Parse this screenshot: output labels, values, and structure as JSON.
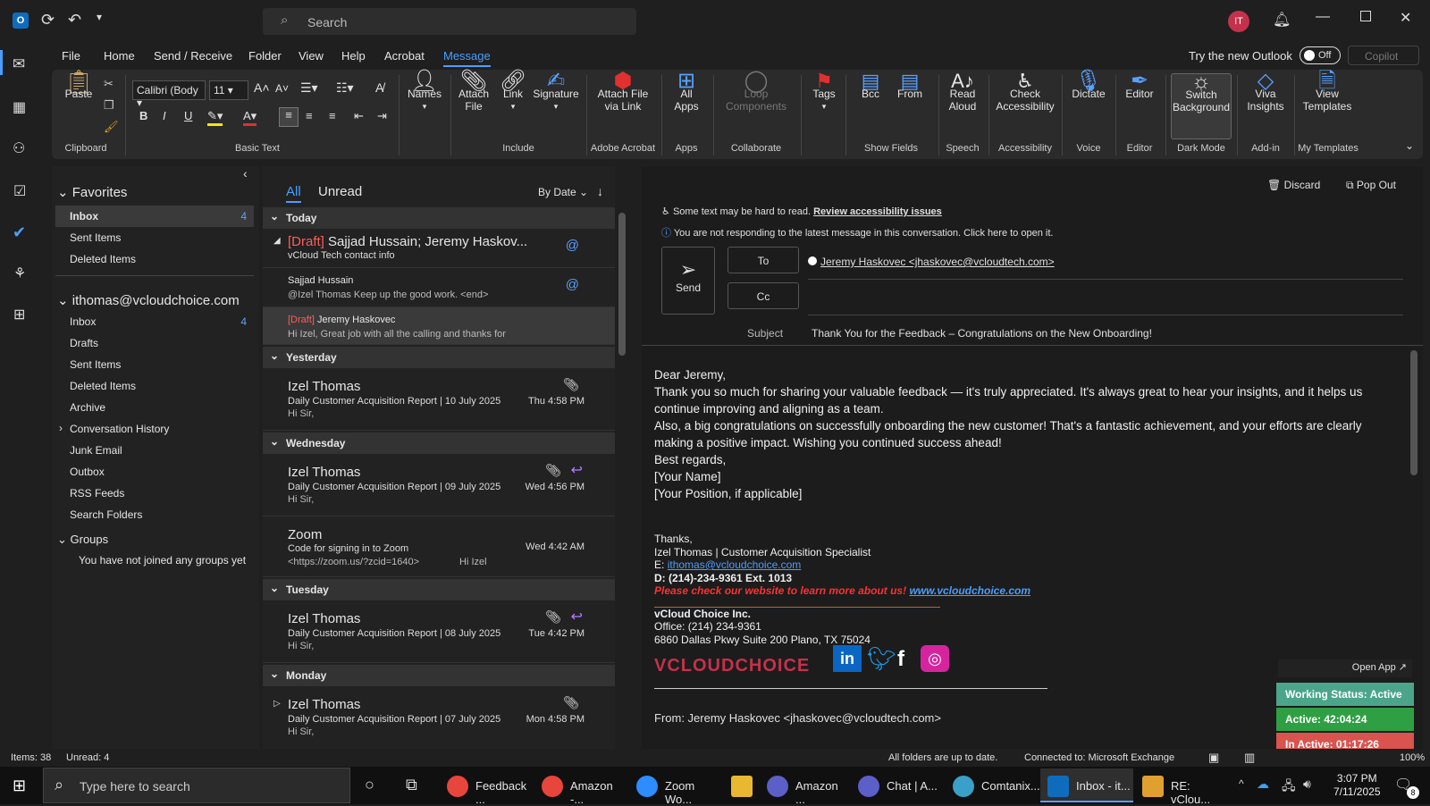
{
  "titlebar": {
    "search_placeholder": "Search",
    "avatar": "IT"
  },
  "menu": {
    "items": [
      "File",
      "Home",
      "Send / Receive",
      "Folder",
      "View",
      "Help",
      "Acrobat",
      "Message"
    ],
    "try_new": "Try the new Outlook",
    "toggle": "Off",
    "copilot": "Copilot"
  },
  "ribbon": {
    "paste": "Paste",
    "font": "Calibri (Body",
    "size": "11",
    "names": "Names",
    "attach": "Attach\nFile",
    "link": "Link",
    "signature": "Signature",
    "attach_link": "Attach File\nvia Link",
    "all_apps": "All\nApps",
    "loop": "Loop\nComponents",
    "tags": "Tags",
    "bcc": "Bcc",
    "from": "From",
    "read_aloud": "Read\nAloud",
    "check_acc": "Check\nAccessibility",
    "dictate": "Dictate",
    "editor": "Editor",
    "switch_bg": "Switch\nBackground",
    "viva": "Viva\nInsights",
    "view_templates": "View\nTemplates",
    "groups": [
      "Clipboard",
      "Basic Text",
      "Include",
      "Adobe Acrobat",
      "Apps",
      "Collaborate",
      "Show Fields",
      "Speech",
      "Accessibility",
      "Voice",
      "Editor",
      "Dark Mode",
      "Add-in",
      "My Templates"
    ]
  },
  "folders": {
    "favorites": "Favorites",
    "fav_items": [
      {
        "label": "Inbox",
        "count": "4"
      },
      {
        "label": "Sent Items",
        "count": ""
      },
      {
        "label": "Deleted Items",
        "count": ""
      }
    ],
    "account": "ithomas@vcloudchoice.com",
    "acc_items": [
      {
        "label": "Inbox",
        "count": "4"
      },
      {
        "label": "Drafts",
        "count": ""
      },
      {
        "label": "Sent Items",
        "count": ""
      },
      {
        "label": "Deleted Items",
        "count": ""
      },
      {
        "label": "Archive",
        "count": ""
      },
      {
        "label": "Conversation History",
        "count": ""
      },
      {
        "label": "Junk Email",
        "count": ""
      },
      {
        "label": "Outbox",
        "count": ""
      },
      {
        "label": "RSS Feeds",
        "count": ""
      },
      {
        "label": "Search Folders",
        "count": ""
      }
    ],
    "groups": "Groups",
    "groups_msg": "You have not joined any groups yet"
  },
  "list": {
    "tab_all": "All",
    "tab_unread": "Unread",
    "sort": "By Date",
    "h_today": "Today",
    "h_yesterday": "Yesterday",
    "h_wed": "Wednesday",
    "h_tue": "Tuesday",
    "h_mon": "Monday",
    "m1_draft": "[Draft]",
    "m1_sender": "Sajjad Hussain;  Jeremy Haskov...",
    "m1_subj": "vCloud Tech contact info",
    "m2_sender": "Sajjad Hussain",
    "m2_prev": "@Izel Thomas Keep up the good work. <end>",
    "m3_draft": "[Draft]",
    "m3_sender": "Jeremy Haskovec",
    "m3_prev": "Hi Izel,  Great job with all the calling and thanks for",
    "m4_sender": "Izel Thomas",
    "m4_subj": "Daily Customer Acquisition Report | 10 July 2025",
    "m4_time": "Thu 4:58 PM",
    "m4_prev": "Hi Sir,",
    "m5_sender": "Izel Thomas",
    "m5_subj": "Daily Customer Acquisition Report | 09 July 2025",
    "m5_time": "Wed 4:56 PM",
    "m5_prev": "Hi Sir,",
    "m6_sender": "Zoom",
    "m6_subj": "Code for signing in to Zoom",
    "m6_time": "Wed 4:42 AM",
    "m6_prev": "<https://zoom.us/?zcid=1640>",
    "m6_prev2": "Hi Izel",
    "m7_sender": "Izel Thomas",
    "m7_subj": "Daily Customer Acquisition Report | 08 July 2025",
    "m7_time": "Tue 4:42 PM",
    "m7_prev": "Hi Sir,",
    "m8_sender": "Izel Thomas",
    "m8_subj": "Daily Customer Acquisition Report | 07 July 2025",
    "m8_time": "Mon 4:58 PM",
    "m8_prev": "Hi Sir,"
  },
  "compose": {
    "discard": "Discard",
    "popout": "Pop Out",
    "access_msg": "Some text may be hard to read.",
    "access_link": "Review accessibility issues",
    "info_msg": "You are not responding to the latest message in this conversation. Click here to open it.",
    "send": "Send",
    "to": "To",
    "cc": "Cc",
    "to_value": "Jeremy Haskovec <jhaskovec@vcloudtech.com>",
    "subject_label": "Subject",
    "subject": "Thank You for the Feedback – Congratulations on the New Onboarding!",
    "body": [
      "Dear Jeremy,",
      "Thank you so much for sharing your valuable feedback — it's truly appreciated. It's always great to hear your insights, and it helps us continue improving and aligning as a team.",
      "Also, a big congratulations on successfully onboarding the new customer! That's a fantastic achievement, and your efforts are clearly making a positive impact. Wishing you continued success ahead!",
      "Best regards,",
      "[Your Name]",
      "[Your Position, if applicable]"
    ],
    "sig_thanks": "Thanks,",
    "sig_name": "Izel Thomas | Customer Acquisition Specialist",
    "sig_email_label": "E:",
    "sig_email": "ithomas@vcloudchoice.com",
    "sig_phone": "D: (214)-234-9361 Ext. 1013",
    "sig_web_msg": "Please check our website to learn more about us!",
    "sig_web": "www.vcloudchoice.com",
    "company": "vCloud Choice Inc.",
    "office": "Office: (214) 234-9361",
    "address": "6860 Dallas Pkwy Suite 200 Plano, TX 75024",
    "logo": "VCLOUDCHOICE",
    "from_line": "From: Jeremy Haskovec <jhaskovec@vcloudtech.com>"
  },
  "widget": {
    "open_app": "Open App",
    "working": "Working Status: Active",
    "active": "Active: 42:04:24",
    "inactive": "In Active: 01:17:26"
  },
  "status": {
    "items": "Items: 38",
    "unread": "Unread: 4",
    "sync": "All folders are up to date.",
    "connected": "Connected to: Microsoft Exchange",
    "zoom": "100%"
  },
  "taskbar": {
    "search": "Type here to search",
    "apps": [
      "Feedback ...",
      "Amazon -...",
      "Zoom Wo...",
      "",
      "Amazon ...",
      "Chat | A...",
      "Comtanix...",
      "Inbox - it...",
      "RE: vClou..."
    ],
    "time": "3:07 PM",
    "date": "7/11/2025",
    "notif": "8"
  },
  "colors": {
    "accent": "#4a9eff",
    "draft": "#ff5c5c",
    "active_green": "#2ea043",
    "inactive_red": "#d9534f",
    "working_teal": "#4aa58a"
  }
}
